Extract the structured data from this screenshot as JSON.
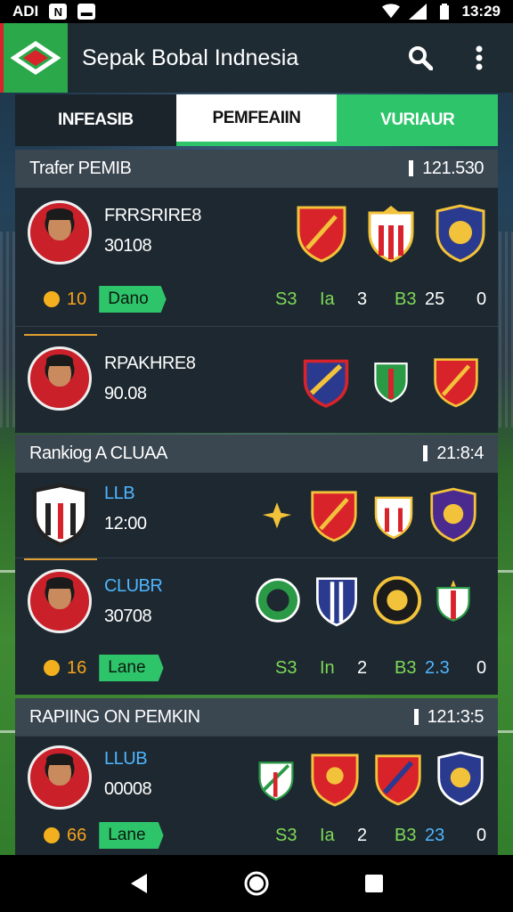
{
  "status_bar": {
    "carrier": "ADI",
    "time": "13:29",
    "icons": [
      "n-icon",
      "message-icon",
      "wifi-icon",
      "signal-icon",
      "battery-icon"
    ]
  },
  "app_bar": {
    "title": "Sepak Bobal Indnesia",
    "icons": [
      "search-icon",
      "more-vert-icon"
    ]
  },
  "tabs": [
    {
      "label": "INFEASIB"
    },
    {
      "label": "PEMFEAIIN"
    },
    {
      "label": "VURIAUR"
    }
  ],
  "sections": [
    {
      "title": "Trafer PEMIB",
      "right_value": "121.530",
      "rows": [
        {
          "name": "FRRSRIRE8",
          "value": "30108",
          "coin_value": "10",
          "pill": "Dano",
          "stats": {
            "s": "S3",
            "ia": "Ia",
            "a_val": "3",
            "b": "B3",
            "b_val": "25",
            "zero": "0"
          }
        },
        {
          "name": "RPAKHRE8",
          "value": "90.08"
        }
      ]
    },
    {
      "title": "Rankiog A CLUAA",
      "right_value": "21:8:4",
      "rows": [
        {
          "name": "LLB",
          "value": "12:00"
        },
        {
          "name": "CLUBR",
          "value": "30708",
          "coin_value": "16",
          "pill": "Lane",
          "stats": {
            "s": "S3",
            "ia": "In",
            "a_val": "2",
            "b": "B3",
            "b_val": "2.3",
            "zero": "0"
          }
        }
      ]
    },
    {
      "title": "RAPIING ON PEMKIN",
      "right_value": "121:3:5",
      "rows": [
        {
          "name": "LLUB",
          "value": "00008",
          "coin_value": "66",
          "pill": "Lane",
          "stats": {
            "s": "S3",
            "ia": "Ia",
            "a_val": "2",
            "b": "B3",
            "b_val": "23",
            "zero": "0"
          }
        }
      ]
    }
  ],
  "colors": {
    "accent_green": "#2ec46a",
    "brand_red": "#d8232a",
    "stat_orange": "#f7a21b",
    "stat_blue": "#4fb6ff"
  },
  "nav_bar": {
    "icons": [
      "back-icon",
      "home-icon",
      "recents-icon"
    ]
  }
}
